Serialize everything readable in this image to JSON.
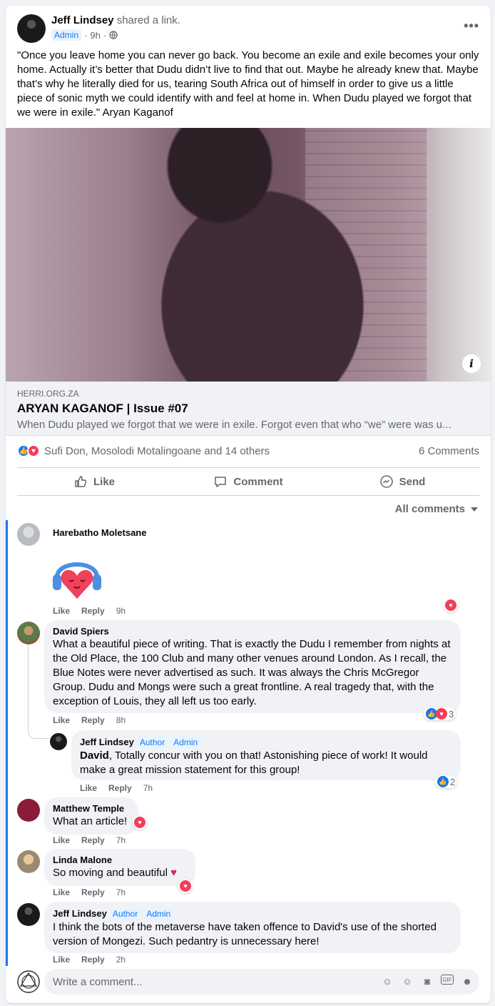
{
  "post": {
    "author": "Jeff Lindsey",
    "action": "shared a link.",
    "badge": "Admin",
    "time": "9h",
    "body": "\"Once you leave home you can never go back. You become an exile and exile becomes your only home. Actually it’s better that Dudu didn’t live to find that out. Maybe he already knew that. Maybe that’s why he literally died for us, tearing South Africa out of himself in order to give us a little piece of sonic myth we could identify with and feel at home in. When Dudu played we forgot that we were in exile.\" Aryan Kaganof"
  },
  "link": {
    "domain": "HERRI.ORG.ZA",
    "title": "ARYAN KAGANOF | Issue #07",
    "description": "When Dudu played we forgot that we were in exile. Forgot even that who “we” were was u..."
  },
  "stats": {
    "reaction_names": "Sufi Don, Mosolodi Motalingoane and 14 others",
    "comments": "6 Comments"
  },
  "actions": {
    "like": "Like",
    "comment": "Comment",
    "send": "Send"
  },
  "sort_label": "All comments",
  "comments": [
    {
      "name": "Harebatho Moletsane",
      "text": "",
      "like": "Like",
      "reply": "Reply",
      "time": "9h"
    },
    {
      "name": "David Spiers",
      "text": "What a beautiful piece of writing. That is exactly the Dudu I remember from nights at the Old Place, the 100 Club and many other venues around London. As I recall, the Blue Notes were never advertised as such. It was always the Chris McGregor Group. Dudu and Mongs were such a great frontline. A real tragedy that, with the exception of Louis, they all left us too early.",
      "like": "Like",
      "reply": "Reply",
      "time": "8h",
      "reaction_count": "3"
    },
    {
      "name": "Jeff Lindsey",
      "badge1": "Author",
      "badge2": "Admin",
      "mention": "David",
      "text": ", Totally concur with you on that! Astonishing piece of work! It would make a great mission statement for this group!",
      "like": "Like",
      "reply": "Reply",
      "time": "7h",
      "reaction_count": "2"
    },
    {
      "name": "Matthew Temple",
      "text": "What an article!",
      "like": "Like",
      "reply": "Reply",
      "time": "7h"
    },
    {
      "name": "Linda Malone",
      "text": "So moving and beautiful",
      "like": "Like",
      "reply": "Reply",
      "time": "7h"
    },
    {
      "name": "Jeff Lindsey",
      "badge1": "Author",
      "badge2": "Admin",
      "text": "I think the bots of the metaverse have taken offence to David's use of the shorted version of Mongezi. Such pedantry is unnecessary here!",
      "like": "Like",
      "reply": "Reply",
      "time": "2h"
    }
  ],
  "composer": {
    "placeholder": "Write a comment..."
  },
  "icons": {
    "more": "more-horizontal-icon",
    "privacy": "globe-icon",
    "info": "info-icon",
    "like": "thumbs-up-icon",
    "comment": "comment-bubble-icon",
    "send": "messenger-icon",
    "sticker": "heart-headphones-sticker"
  },
  "colors": {
    "accent": "#1877f2",
    "love": "#f33e58",
    "bubble": "#f0f2f5",
    "secondary_text": "#65676b"
  }
}
